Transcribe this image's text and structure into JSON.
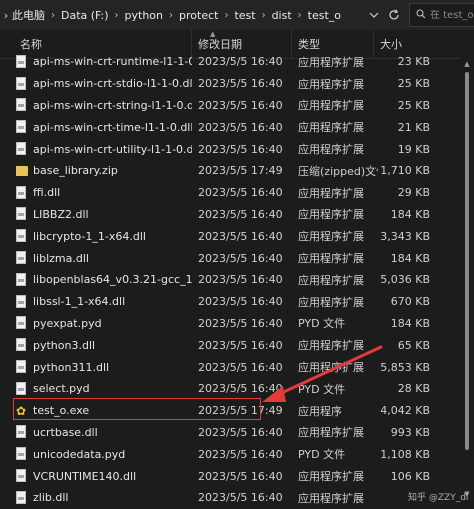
{
  "breadcrumb": [
    "此电脑",
    "Data (F:)",
    "python",
    "protect",
    "test",
    "dist",
    "test_o"
  ],
  "search": {
    "placeholder": "在 test_o 中搜"
  },
  "columns": {
    "name": "名称",
    "date": "修改日期",
    "type": "类型",
    "size": "大小"
  },
  "files": [
    {
      "name": "api-ms-win-crt-runtime-l1-1-0.dll",
      "date": "2023/5/5 16:40",
      "type": "应用程序扩展",
      "size": "23 KB",
      "icon": "dll-file-icon"
    },
    {
      "name": "api-ms-win-crt-stdio-l1-1-0.dll",
      "date": "2023/5/5 16:40",
      "type": "应用程序扩展",
      "size": "25 KB",
      "icon": "dll-file-icon"
    },
    {
      "name": "api-ms-win-crt-string-l1-1-0.dll",
      "date": "2023/5/5 16:40",
      "type": "应用程序扩展",
      "size": "25 KB",
      "icon": "dll-file-icon"
    },
    {
      "name": "api-ms-win-crt-time-l1-1-0.dll",
      "date": "2023/5/5 16:40",
      "type": "应用程序扩展",
      "size": "21 KB",
      "icon": "dll-file-icon"
    },
    {
      "name": "api-ms-win-crt-utility-l1-1-0.dll",
      "date": "2023/5/5 16:40",
      "type": "应用程序扩展",
      "size": "19 KB",
      "icon": "dll-file-icon"
    },
    {
      "name": "base_library.zip",
      "date": "2023/5/5 17:49",
      "type": "压缩(zipped)文件...",
      "size": "1,710 KB",
      "icon": "zip-file-icon"
    },
    {
      "name": "ffi.dll",
      "date": "2023/5/5 16:40",
      "type": "应用程序扩展",
      "size": "29 KB",
      "icon": "dll-file-icon"
    },
    {
      "name": "LIBBZ2.dll",
      "date": "2023/5/5 16:40",
      "type": "应用程序扩展",
      "size": "184 KB",
      "icon": "dll-file-icon"
    },
    {
      "name": "libcrypto-1_1-x64.dll",
      "date": "2023/5/5 16:40",
      "type": "应用程序扩展",
      "size": "3,343 KB",
      "icon": "dll-file-icon"
    },
    {
      "name": "liblzma.dll",
      "date": "2023/5/5 16:40",
      "type": "应用程序扩展",
      "size": "184 KB",
      "icon": "dll-file-icon"
    },
    {
      "name": "libopenblas64_v0.3.21-gcc_10_3_0.dll",
      "date": "2023/5/5 16:40",
      "type": "应用程序扩展",
      "size": "35,036 KB",
      "icon": "dll-file-icon"
    },
    {
      "name": "libssl-1_1-x64.dll",
      "date": "2023/5/5 16:40",
      "type": "应用程序扩展",
      "size": "670 KB",
      "icon": "dll-file-icon"
    },
    {
      "name": "pyexpat.pyd",
      "date": "2023/5/5 16:40",
      "type": "PYD 文件",
      "size": "184 KB",
      "icon": "pyd-file-icon"
    },
    {
      "name": "python3.dll",
      "date": "2023/5/5 16:40",
      "type": "应用程序扩展",
      "size": "65 KB",
      "icon": "dll-file-icon"
    },
    {
      "name": "python311.dll",
      "date": "2023/5/5 16:40",
      "type": "应用程序扩展",
      "size": "5,853 KB",
      "icon": "dll-file-icon"
    },
    {
      "name": "select.pyd",
      "date": "2023/5/5 16:40",
      "type": "PYD 文件",
      "size": "28 KB",
      "icon": "pyd-file-icon"
    },
    {
      "name": "test_o.exe",
      "date": "2023/5/5 17:49",
      "type": "应用程序",
      "size": "4,042 KB",
      "icon": "exe-file-icon"
    },
    {
      "name": "ucrtbase.dll",
      "date": "2023/5/5 16:40",
      "type": "应用程序扩展",
      "size": "993 KB",
      "icon": "dll-file-icon"
    },
    {
      "name": "unicodedata.pyd",
      "date": "2023/5/5 16:40",
      "type": "PYD 文件",
      "size": "1,108 KB",
      "icon": "pyd-file-icon"
    },
    {
      "name": "VCRUNTIME140.dll",
      "date": "2023/5/5 16:40",
      "type": "应用程序扩展",
      "size": "106 KB",
      "icon": "dll-file-icon"
    },
    {
      "name": "zlib.dll",
      "date": "2023/5/5 16:40",
      "type": "应用程序扩展",
      "size": "",
      "icon": "dll-file-icon"
    }
  ],
  "annotation": {
    "highlight_color": "#e33a3a"
  },
  "watermark": "知乎 @ZZY_dl"
}
